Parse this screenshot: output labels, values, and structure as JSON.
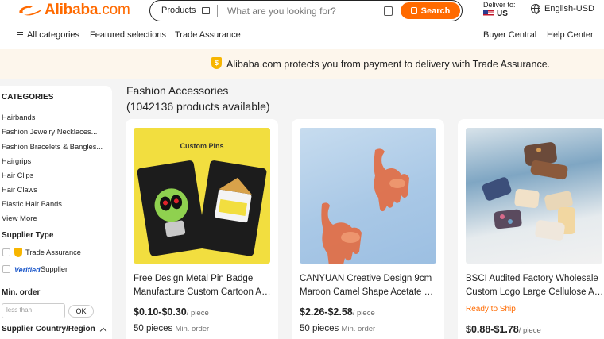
{
  "header": {
    "logo_text": "Alibaba",
    "logo_domain": ".com",
    "search": {
      "category_label": "Products",
      "placeholder": "What are you looking for?",
      "button_label": "Search"
    },
    "deliver_to_label": "Deliver to:",
    "deliver_to_country": "US",
    "language_currency": "English-USD"
  },
  "nav": {
    "all_categories": "All categories",
    "featured": "Featured selections",
    "trade_assurance": "Trade Assurance",
    "buyer_central": "Buyer Central",
    "help_center": "Help Center"
  },
  "banner": {
    "icon_glyph": "$",
    "text": "Alibaba.com protects you from payment to delivery with Trade Assurance."
  },
  "sidebar": {
    "categories_title": "CATEGORIES",
    "categories": [
      "Hairbands",
      "Fashion Jewelry Necklaces...",
      "Fashion Bracelets & Bangles...",
      "Hairgrips",
      "Hair Clips",
      "Hair Claws",
      "Elastic Hair Bands"
    ],
    "view_more": "View More",
    "supplier_type_title": "Supplier Type",
    "trade_assurance_option": "Trade Assurance",
    "verified_badge": "Verified",
    "verified_option": "Supplier",
    "min_order_title": "Min. order",
    "min_order_placeholder": "less than",
    "ok_button": "OK",
    "country_region_title": "Supplier Country/Region"
  },
  "main": {
    "title": "Fashion Accessories",
    "product_count": "(1042136 products available)"
  },
  "products": [
    {
      "image_alt": "Custom metal pin badges",
      "image_caption": "Custom Pins",
      "title_line1": "Free Design Metal Pin Badge",
      "title_line2": "Manufacture Custom Cartoon Anime",
      "price": "$0.10-$0.30",
      "price_unit": "/ piece",
      "moq": "50 pieces",
      "moq_label": "Min. order"
    },
    {
      "image_alt": "Camel shape acetate hair claws",
      "title_line1": "CANYUAN Creative Design 9cm",
      "title_line2": "Maroon Camel Shape Acetate Hair",
      "price": "$2.26-$2.58",
      "price_unit": "/ piece",
      "moq": "50 pieces",
      "moq_label": "Min. order"
    },
    {
      "image_alt": "Assorted cellulose acetate hair claw clips",
      "title_line1": "BSCI Audited Factory Wholesale",
      "title_line2": "Custom Logo Large Cellulose Acetate",
      "ready_to_ship": "Ready to Ship",
      "price": "$0.88-$1.78",
      "price_unit": "/ piece"
    }
  ],
  "colors": {
    "brand_orange": "#ff6a00",
    "banner_bg": "#fdf6ec",
    "page_bg": "#f4f4f4"
  }
}
